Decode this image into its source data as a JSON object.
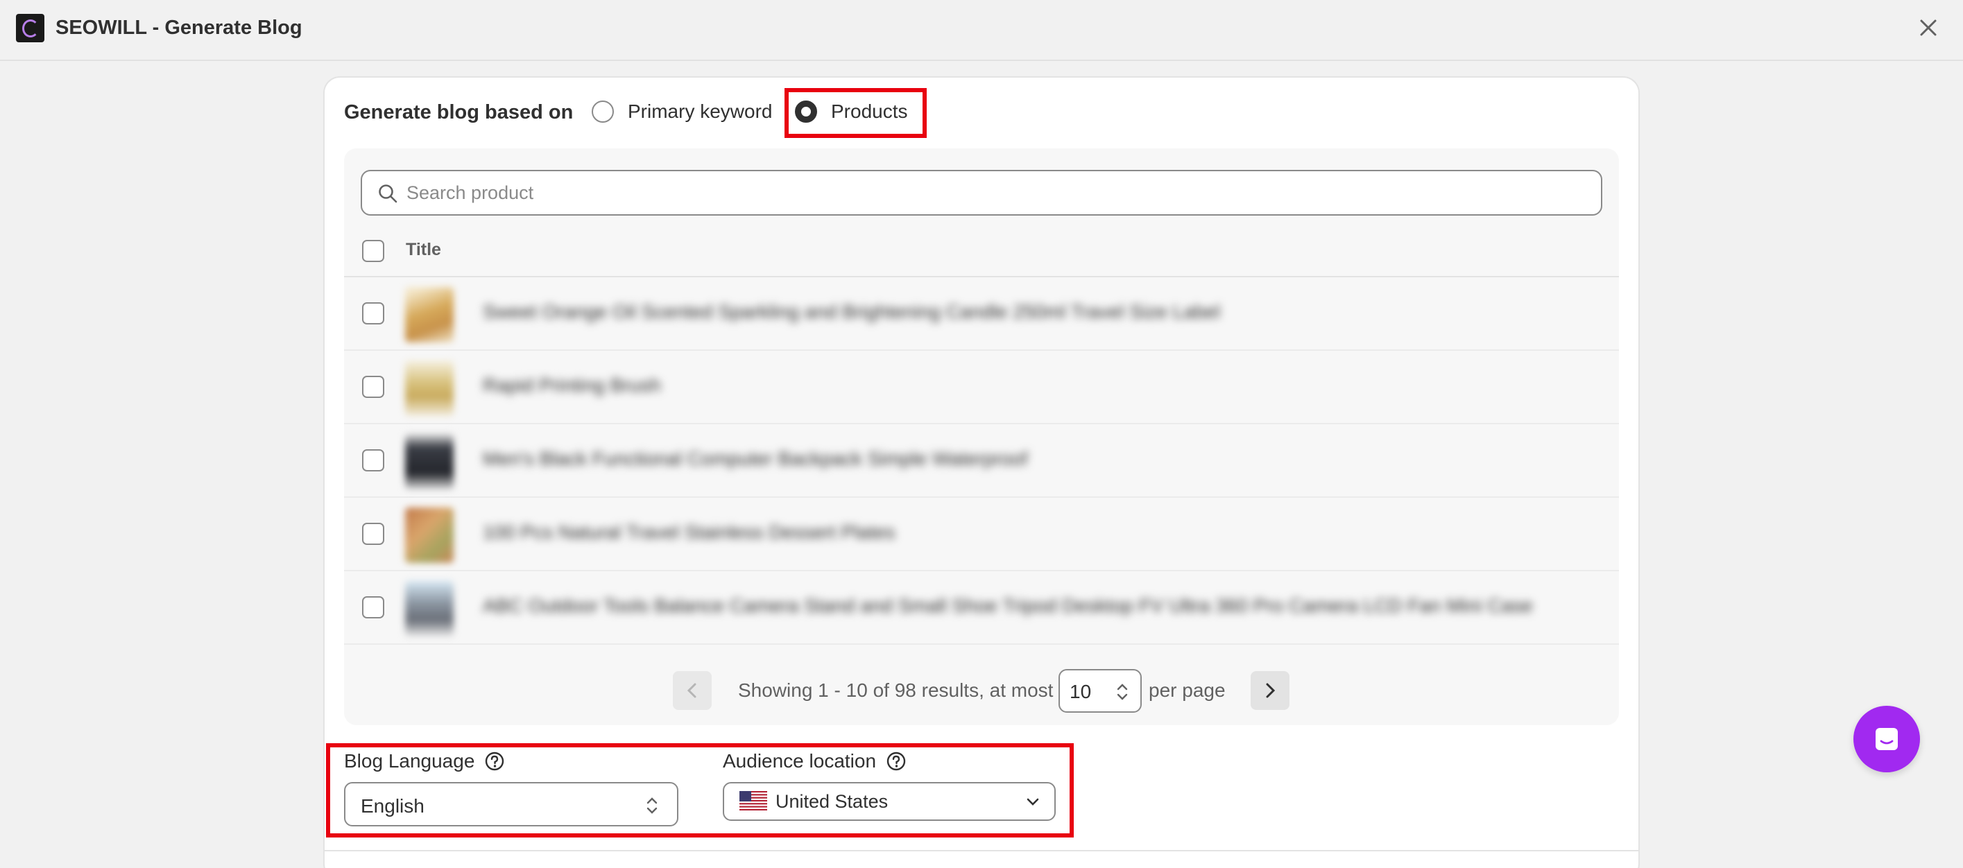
{
  "app": {
    "title": "SEOWILL - Generate Blog"
  },
  "generate": {
    "based_on_label": "Generate blog based on",
    "options": [
      {
        "label": "Primary keyword",
        "selected": false
      },
      {
        "label": "Products",
        "selected": true
      }
    ]
  },
  "search": {
    "placeholder": "Search product",
    "value": ""
  },
  "table": {
    "column_title": "Title",
    "rows": [
      {
        "title": "Sweet Orange Oil Scented Sparkling and Brightening Candle 250ml Travel Size Label"
      },
      {
        "title": "Rapid Printing Brush"
      },
      {
        "title": "Men's Black Functional Computer Backpack Simple Waterproof"
      },
      {
        "title": "100 Pcs Natural Travel Stainless Dessert Plates"
      },
      {
        "title": "ABC Outdoor Tools Balance Camera Stand and Small Shoe Tripod Desktop FV Ultra 360 Pro Camera LCD Fan Mini Case"
      }
    ]
  },
  "pagination": {
    "showing_text": "Showing 1 - 10 of 98 results, at most",
    "per_page_value": "10",
    "per_page_label": "per page"
  },
  "blog_language": {
    "label": "Blog Language",
    "value": "English"
  },
  "audience_location": {
    "label": "Audience location",
    "value": "United States"
  },
  "colors": {
    "accent_highlight": "#e8000f",
    "chat_button": "#a129f0"
  },
  "icons": [
    "app-logo-icon",
    "close-icon",
    "search-icon",
    "help-icon",
    "us-flag-icon",
    "chevron-down-icon",
    "chat-icon"
  ]
}
